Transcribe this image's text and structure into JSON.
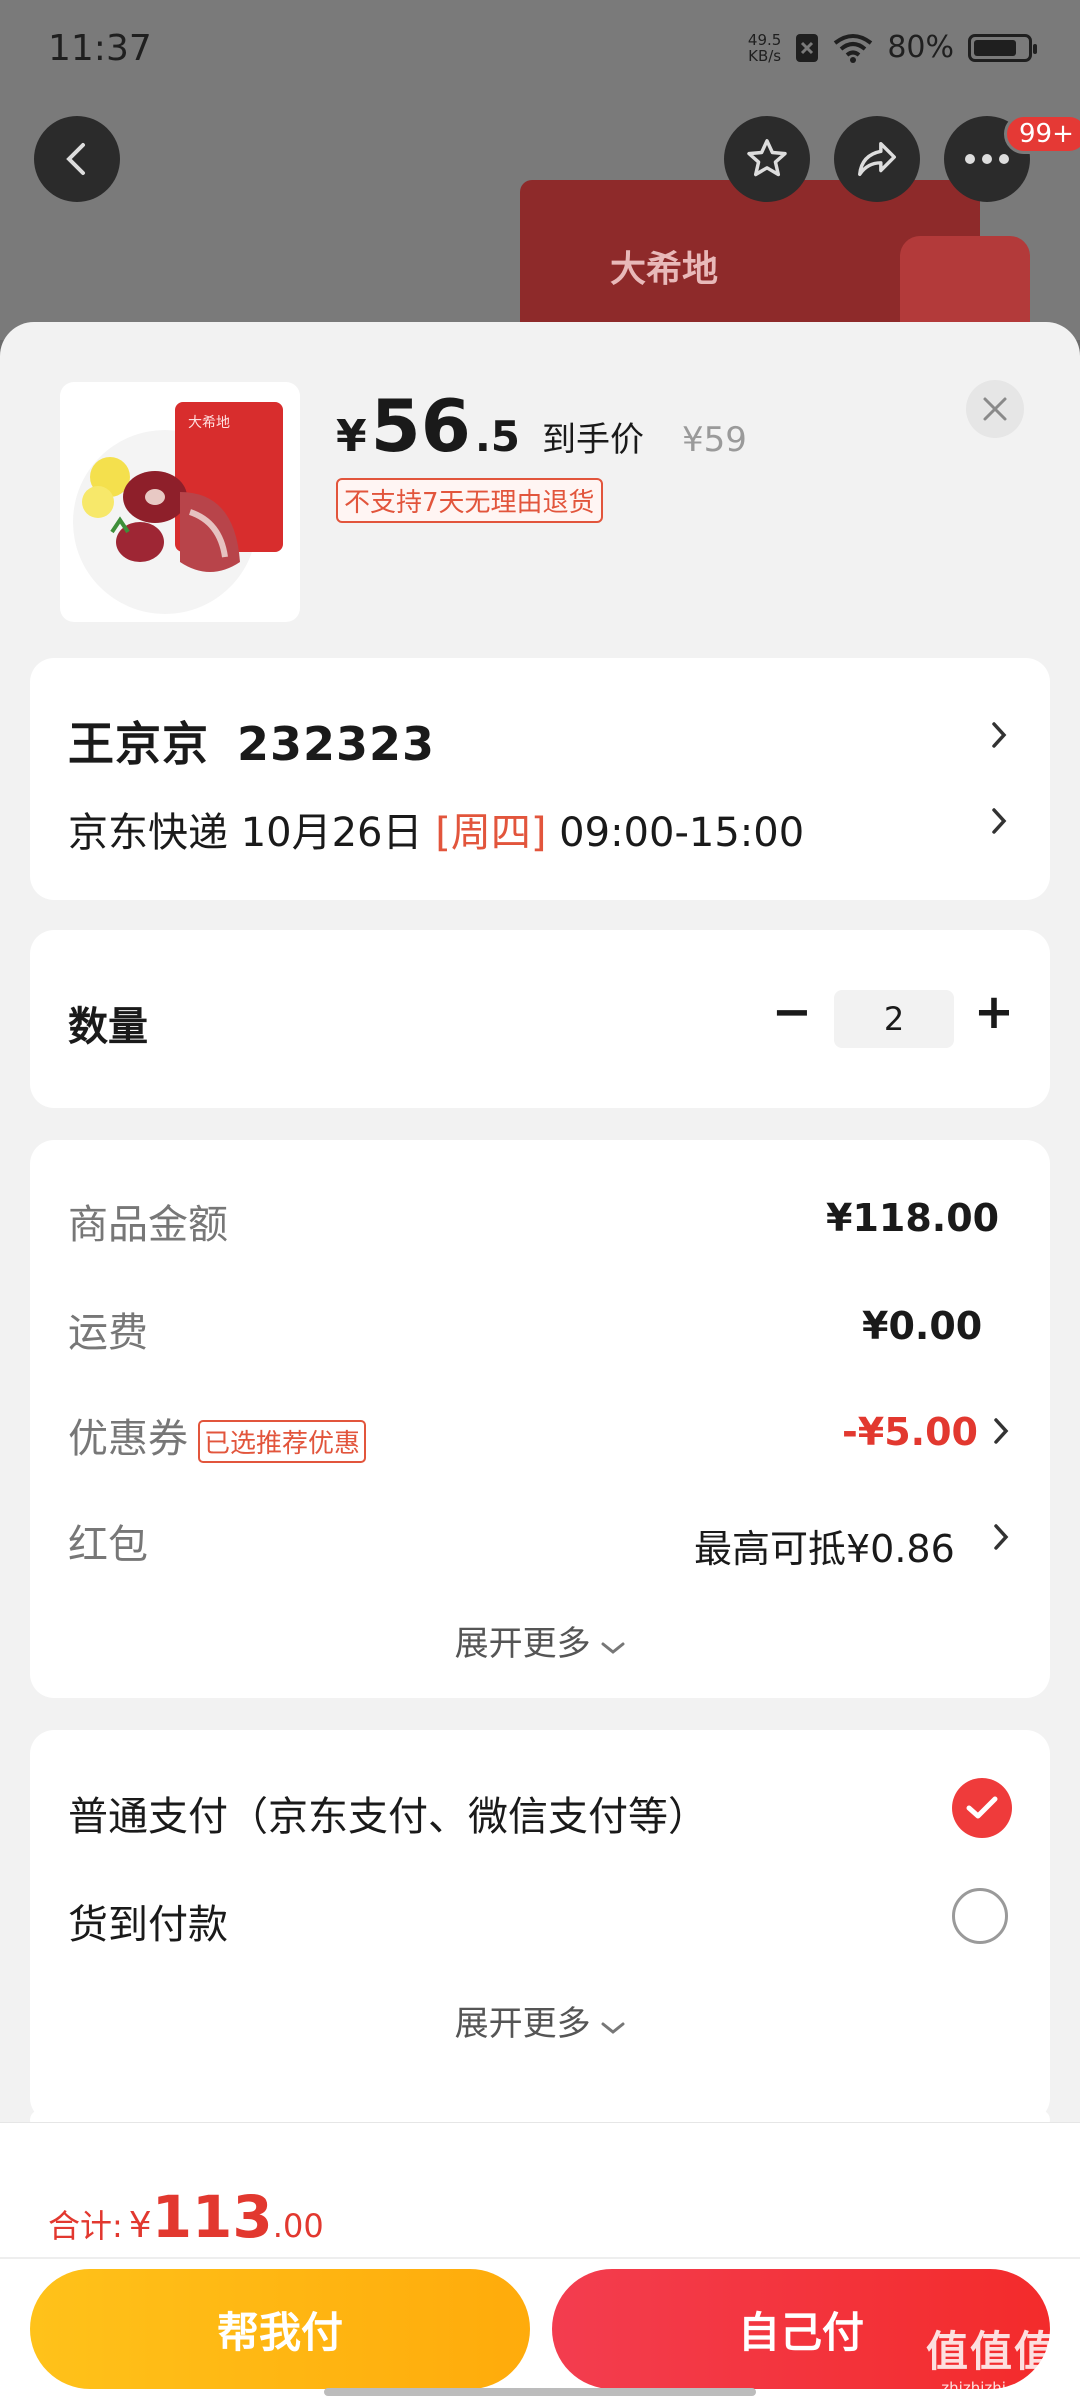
{
  "status": {
    "time": "11:37",
    "net_speed_top": "49.5",
    "net_speed_bottom": "KB/s",
    "battery": "80%"
  },
  "header": {
    "badge": "99+",
    "icons": [
      "back-icon",
      "star-icon",
      "share-icon",
      "more-icon"
    ]
  },
  "background_product": {
    "brand_text": "大希地"
  },
  "product": {
    "price_symbol": "¥",
    "price_int": "56",
    "price_dec": ".5",
    "price_label": "到手价",
    "original_price": "¥59",
    "return_policy": "不支持7天无理由退货",
    "thumb_brand": "大希地"
  },
  "address": {
    "name": "王京京",
    "phone": "232323"
  },
  "delivery": {
    "carrier_date": "京东快递 10月26日",
    "weekday": "[周四]",
    "time": "09:00-15:00"
  },
  "quantity": {
    "label": "数量",
    "value": "2",
    "minus": "−",
    "plus": "+"
  },
  "fees": {
    "goods_label": "商品金额",
    "goods_value": "¥118.00",
    "shipping_label": "运费",
    "shipping_value": "¥0.00",
    "coupon_label": "优惠券",
    "coupon_tag": "已选推荐优惠",
    "coupon_value": "-¥5.00",
    "redpacket_label": "红包",
    "redpacket_value": "最高可抵¥0.86",
    "more": "展开更多"
  },
  "payment": {
    "option1": "普通支付（京东支付、微信支付等）",
    "option2": "货到付款",
    "more": "展开更多",
    "selected": "option1"
  },
  "footer": {
    "total_label": "合计:",
    "total_yen": "¥",
    "total_int": "113",
    "total_dec": ".00",
    "help_pay": "帮我付",
    "self_pay": "自己付"
  },
  "watermark": {
    "main": "值值值",
    "sub": "zhizhizhi.com"
  },
  "colors": {
    "accent_red": "#e2382f",
    "gold": "#ffb812",
    "pay_red": "#f33d4f"
  }
}
